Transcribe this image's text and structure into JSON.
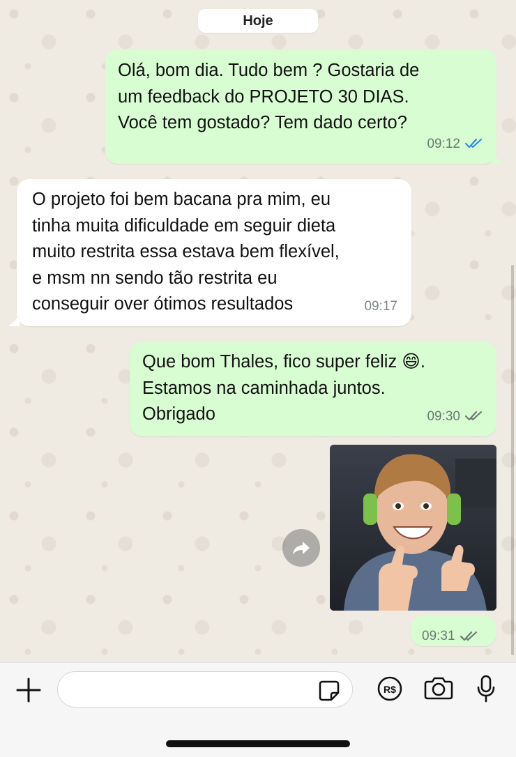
{
  "date_separator": "Hoje",
  "messages": [
    {
      "direction": "outgoing",
      "text": "Olá, bom dia. Tudo bem ? Gostaria de\num feedback do PROJETO 30 DIAS.\nVocê tem gostado? Tem dado certo?",
      "time": "09:12",
      "status": "read",
      "tick_color": "#2d8cf0"
    },
    {
      "direction": "incoming",
      "text": "O projeto foi bem bacana pra mim, eu\ntinha muita dificuldade em seguir dieta\nmuito restrita essa estava bem flexível,\ne msm nn sendo tão restrita eu\nconseguir over ótimos resultados",
      "time": "09:17"
    },
    {
      "direction": "outgoing",
      "text": "Que bom Thales, fico super feliz 😄.\nEstamos na caminhada juntos.\nObrigado",
      "time": "09:30",
      "status": "delivered",
      "tick_color": "#6b7a70"
    },
    {
      "direction": "outgoing",
      "type": "image",
      "image": "boy-thumbs-up-photo",
      "time": "09:31",
      "status": "delivered",
      "tick_color": "#6b7a70"
    }
  ],
  "input": {
    "placeholder": ""
  },
  "icons": [
    "plus-icon",
    "sticker-icon",
    "payment-icon",
    "camera-icon",
    "microphone-icon",
    "forward-icon",
    "double-check-icon"
  ],
  "colors": {
    "outgoing_bubble": "#d9fdd3",
    "incoming_bubble": "#ffffff",
    "chat_background": "#efeae2",
    "read_ticks": "#2d8cf0"
  }
}
